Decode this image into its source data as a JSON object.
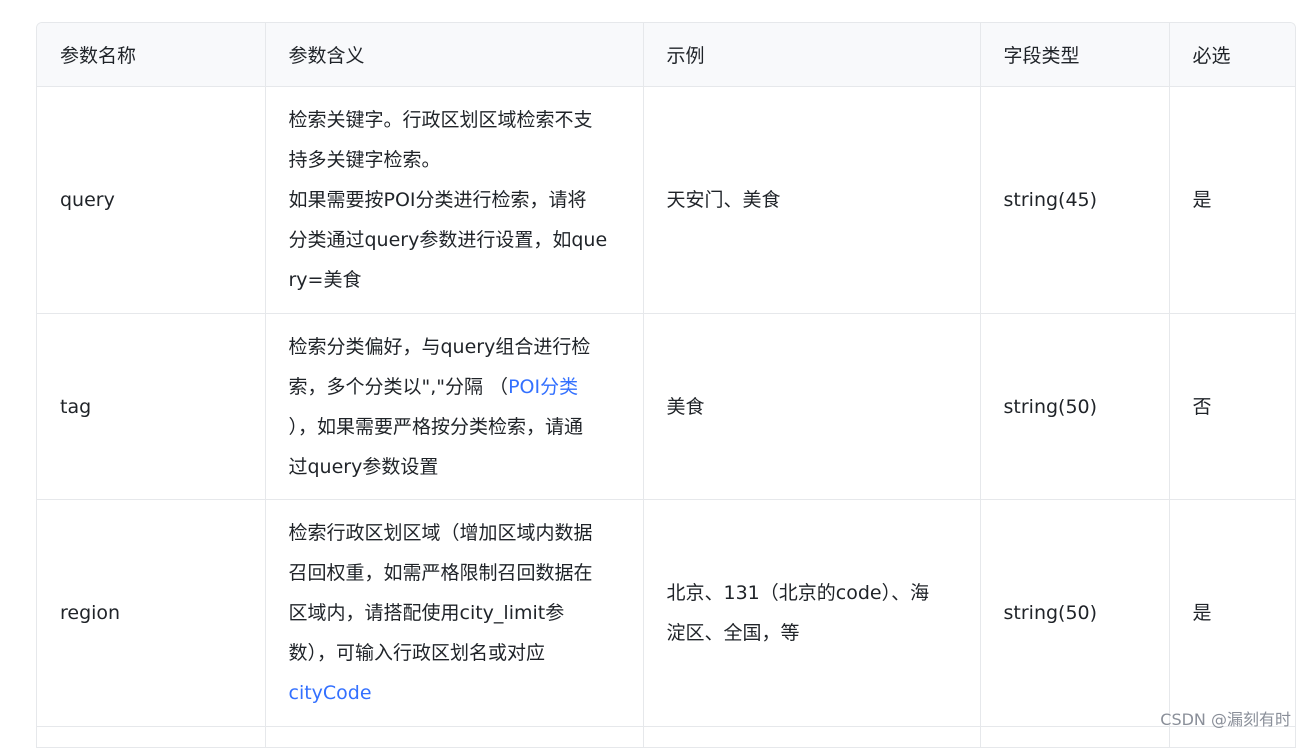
{
  "table": {
    "headers": [
      "参数名称",
      "参数含义",
      "示例",
      "字段类型",
      "必选"
    ],
    "rows": [
      {
        "name": "query",
        "meaning_lines": [
          "检索关键字。行政区划区域检索不支",
          "持多关键字检索。",
          "如果需要按POI分类进行检索，请将",
          "分类通过query参数进行设置，如que",
          "ry=美食"
        ],
        "example": "天安门、美食",
        "type": "string(45)",
        "required": "是"
      },
      {
        "name": "tag",
        "meaning_lines": [
          "检索分类偏好，与query组合进行检",
          "索，多个分类以\",\"分隔 （",
          "），如果需要严格按分类检索，请通",
          "过query参数设置"
        ],
        "meaning_link": "POI分类",
        "example": "美食",
        "type": "string(50)",
        "required": "否"
      },
      {
        "name": "region",
        "meaning_lines": [
          "检索行政区划区域（增加区域内数据",
          "召回权重，如需严格限制召回数据在",
          "区域内，请搭配使用city_limit参",
          "数），可输入行政区划名或对应"
        ],
        "meaning_link": "cityCode",
        "example_lines": [
          "北京、131（北京的code）、海",
          "淀区、全国，等"
        ],
        "type": "string(50)",
        "required": "是"
      }
    ]
  },
  "watermark": "CSDN @漏刻有时",
  "colors": {
    "link": "#3370ff",
    "header_bg": "#f8f9fb",
    "border": "#e6e8eb"
  }
}
